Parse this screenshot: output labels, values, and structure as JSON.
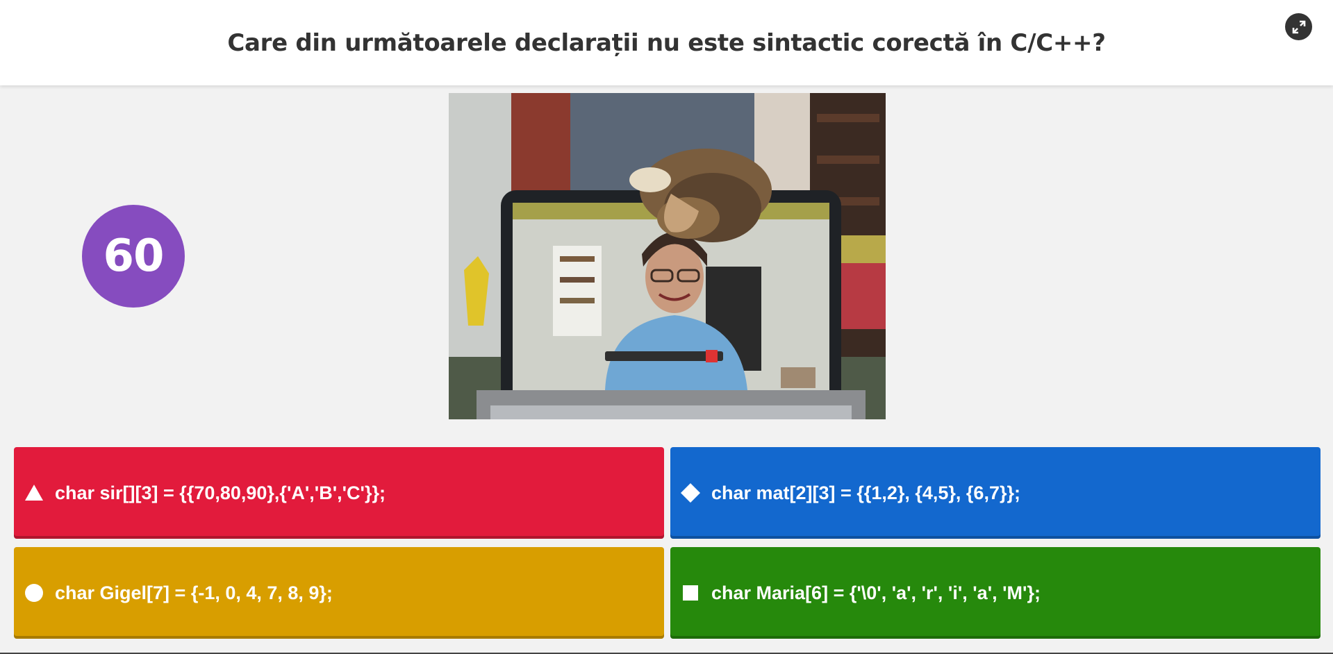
{
  "question": {
    "text": "Care din următoarele declarații nu este sintactic corectă în C/C++?"
  },
  "controls": {
    "fullscreen_icon": "expand-icon"
  },
  "timer": {
    "seconds": "60",
    "color": "#864cbf"
  },
  "media": {
    "description_icon": "question-image"
  },
  "answers": [
    {
      "shape": "triangle",
      "color": "#e21b3c",
      "text": "char sir[][3] = {{70,80,90},{'A','B','C'}};"
    },
    {
      "shape": "diamond",
      "color": "#1368ce",
      "text": "char mat[2][3] = {{1,2}, {4,5}, {6,7}};"
    },
    {
      "shape": "circle",
      "color": "#d89e00",
      "text": "char Gigel[7] = {-1, 0, 4, 7, 8, 9};"
    },
    {
      "shape": "square",
      "color": "#26890c",
      "text": "char Maria[6] = {'\\0', 'a', 'r', 'i', 'a', 'M'};"
    }
  ]
}
